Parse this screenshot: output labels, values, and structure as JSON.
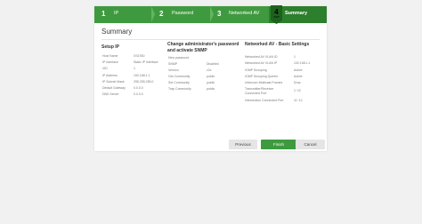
{
  "steps": [
    {
      "number": "1",
      "label": "IP"
    },
    {
      "number": "2",
      "label": "Password"
    },
    {
      "number": "3",
      "label": "Networked AV"
    }
  ],
  "active_step": {
    "number": "4",
    "sub": "STEP",
    "label": "Summary"
  },
  "title": "Summary",
  "setup_ip": {
    "title": "Setup IP",
    "rows": [
      {
        "key": "Host Name",
        "value": "XS1930"
      },
      {
        "key": "IP Interface",
        "value": "Static IP Interface"
      },
      {
        "key": "VID",
        "value": "1"
      },
      {
        "key": "IP Address",
        "value": "192.168.1.1"
      },
      {
        "key": "IP Subnet Mask",
        "value": "255.255.255.0"
      },
      {
        "key": "Default Gateway",
        "value": "0.0.0.0"
      },
      {
        "key": "DNS Server",
        "value": "0.0.0.0"
      }
    ]
  },
  "snmp": {
    "title_line1": "Change administrator's password",
    "title_line2": "and activate SNMP",
    "rows": [
      {
        "key": "New password",
        "value": ""
      },
      {
        "key": "SNMP",
        "value": "Disabled"
      },
      {
        "key": "Version",
        "value": "v2c"
      },
      {
        "key": "Get Community",
        "value": "public"
      },
      {
        "key": "Set Community",
        "value": "public"
      },
      {
        "key": "Trap Community",
        "value": "public"
      }
    ]
  },
  "networked_av": {
    "title": "Networked AV - Basic Settings",
    "rows": [
      {
        "key": "Networked AV VLAN ID",
        "value": "1"
      },
      {
        "key": "Networked AV VLAN IP",
        "value": "192.168.1.1"
      },
      {
        "key": "IGMP Snooping",
        "value": "Active"
      },
      {
        "key": "IGMP Snooping Querier",
        "value": "Active"
      },
      {
        "key": "Unknown Multicast Frames",
        "value": "Drop"
      },
      {
        "key": "Transmitter/Receiver Connected Port",
        "value": "1~12"
      },
      {
        "key": "Intersection Connected Port",
        "value": "11~12"
      }
    ]
  },
  "buttons": {
    "previous": "Previous",
    "finish": "Finish",
    "cancel": "Cancel"
  },
  "colors": {
    "accent": "#3f9a3f",
    "active_step": "#2c7f2c",
    "badge": "#1d611d"
  }
}
